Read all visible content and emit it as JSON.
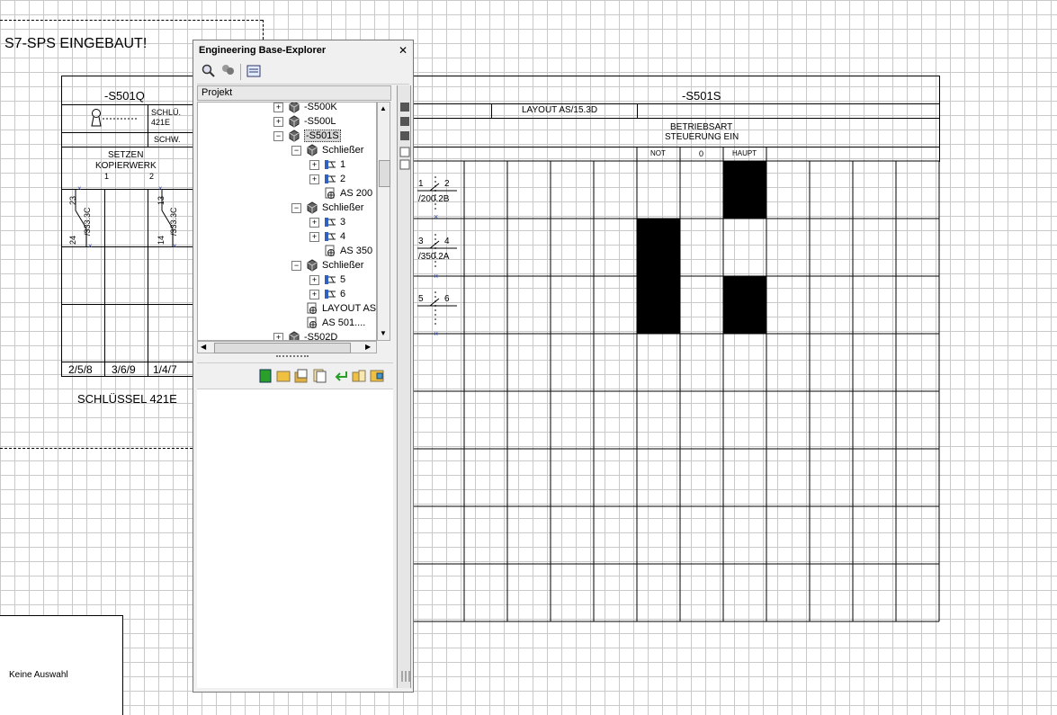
{
  "drawing": {
    "top_text": "S7-SPS EINGEBAUT!",
    "left_block": {
      "title": "-S501Q",
      "schlu_label": "SCHLÜ.",
      "schlu_value": "421E",
      "schw_label": "SCHW.",
      "setzen_line1": "SETZEN",
      "setzen_line2": "KOPIERWERK",
      "col1": "1",
      "col2": "2",
      "contact1_top": "23",
      "contact1_bottom": "24",
      "contact1_ref": "/333.3C",
      "contact2_top": "13",
      "contact2_bottom": "14",
      "contact2_ref": "/333.3C",
      "bottom_cells": [
        "2/5/8",
        "3/6/9",
        "1/4/7"
      ],
      "caption": "SCHLÜSSEL 421E"
    },
    "right_block": {
      "title": "-S501S",
      "layout": "LAYOUT AS/15.3D",
      "betriebsart_line1": "BETRIEBSART",
      "betriebsart_line2": "STEUERUNG EIN",
      "columns": [
        "NOT",
        "0",
        "HAUPT"
      ],
      "contacts": [
        {
          "a": "1",
          "b": "2",
          "ref": "/200.2B"
        },
        {
          "a": "3",
          "b": "4",
          "ref": "/350.2A"
        },
        {
          "a": "5",
          "b": "6",
          "ref": ""
        }
      ]
    },
    "status_box": "Keine Auswahl"
  },
  "explorer": {
    "title": "Engineering Base-Explorer",
    "close": "✕",
    "tab": "Projekt",
    "tree": [
      {
        "label": "-S500K",
        "indent": 0,
        "exp": "+",
        "icon": "device"
      },
      {
        "label": "-S500L",
        "indent": 0,
        "exp": "+",
        "icon": "device"
      },
      {
        "label": "-S501S",
        "indent": 0,
        "exp": "−",
        "icon": "device",
        "selected": true
      },
      {
        "label": "Schließer",
        "indent": 1,
        "exp": "−",
        "icon": "device"
      },
      {
        "label": "1",
        "indent": 2,
        "exp": "+",
        "icon": "contact"
      },
      {
        "label": "2",
        "indent": 2,
        "exp": "+",
        "icon": "contact"
      },
      {
        "label": "AS 200",
        "indent": 2,
        "exp": "",
        "icon": "ref"
      },
      {
        "label": "Schließer",
        "indent": 1,
        "exp": "−",
        "icon": "device"
      },
      {
        "label": "3",
        "indent": 2,
        "exp": "+",
        "icon": "contact"
      },
      {
        "label": "4",
        "indent": 2,
        "exp": "+",
        "icon": "contact"
      },
      {
        "label": "AS 350",
        "indent": 2,
        "exp": "",
        "icon": "ref"
      },
      {
        "label": "Schließer",
        "indent": 1,
        "exp": "−",
        "icon": "device"
      },
      {
        "label": "5",
        "indent": 2,
        "exp": "+",
        "icon": "contact"
      },
      {
        "label": "6",
        "indent": 2,
        "exp": "+",
        "icon": "contact"
      },
      {
        "label": "LAYOUT AS",
        "indent": 1,
        "exp": "",
        "icon": "ref"
      },
      {
        "label": "AS 501....",
        "indent": 1,
        "exp": "",
        "icon": "ref"
      },
      {
        "label": "-S502D",
        "indent": 0,
        "exp": "+",
        "icon": "device"
      }
    ]
  }
}
